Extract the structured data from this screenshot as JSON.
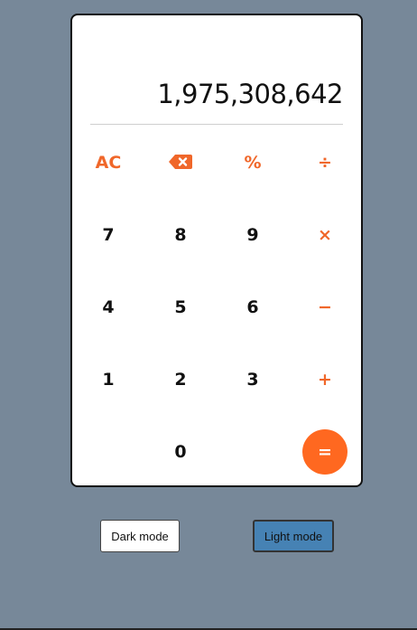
{
  "display": {
    "value": "1,975,308,642"
  },
  "keys": {
    "clear": "AC",
    "backspace_icon": "backspace-icon",
    "percent": "%",
    "divide": "÷",
    "seven": "7",
    "eight": "8",
    "nine": "9",
    "multiply": "×",
    "four": "4",
    "five": "5",
    "six": "6",
    "minus": "−",
    "one": "1",
    "two": "2",
    "three": "3",
    "plus": "+",
    "zero": "0",
    "equals": "="
  },
  "modes": {
    "dark_label": "Dark mode",
    "light_label": "Light mode"
  },
  "colors": {
    "background": "#778899",
    "accent": "#f0672a",
    "equals_bg": "#ff6820",
    "light_mode_button": "#4682b4"
  }
}
